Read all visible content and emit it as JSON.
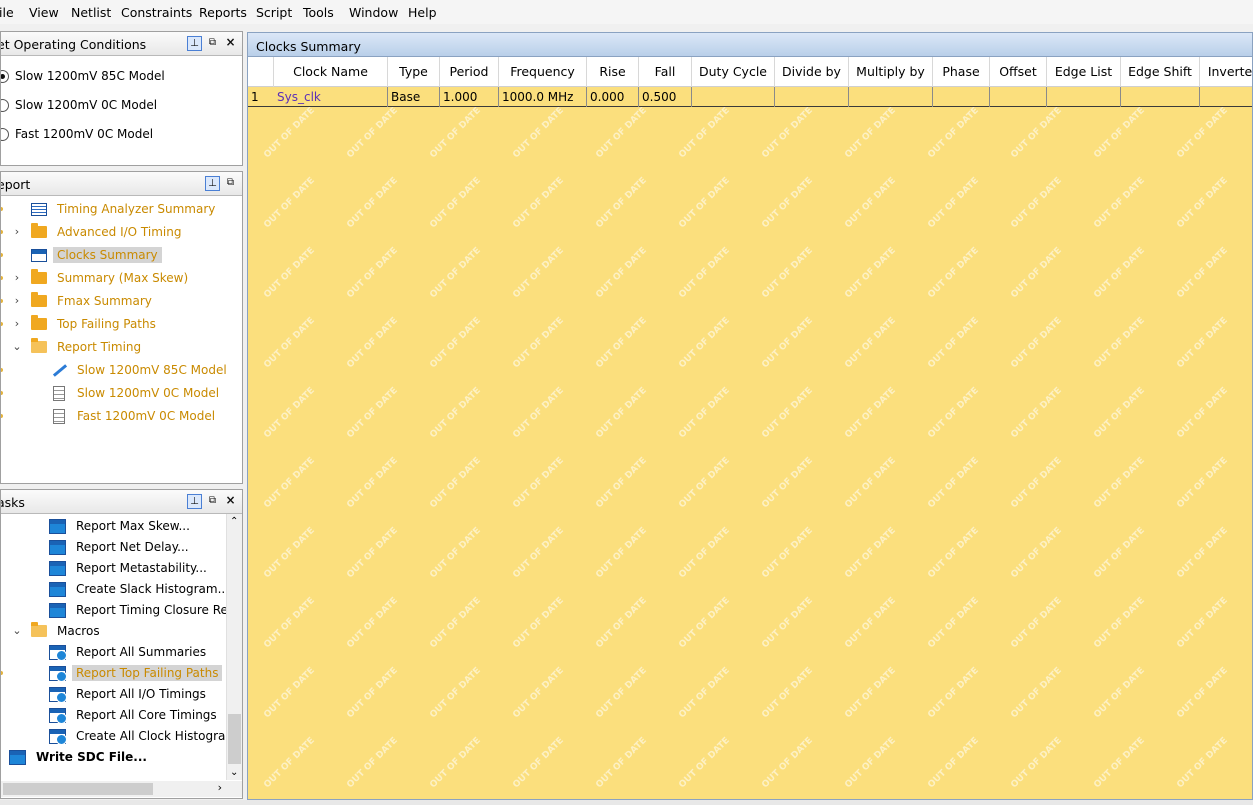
{
  "menubar": [
    "ile",
    "View",
    "Netlist",
    "Constraints",
    "Reports",
    "Script",
    "Tools",
    "Window",
    "Help"
  ],
  "operating_conditions": {
    "title": "et Operating Conditions",
    "options": [
      {
        "label": "Slow 1200mV 85C Model",
        "selected": true
      },
      {
        "label": "Slow 1200mV 0C Model",
        "selected": false
      },
      {
        "label": "Fast 1200mV 0C Model",
        "selected": false
      }
    ]
  },
  "report_panel": {
    "title": "eport",
    "items": [
      {
        "label": "Timing Analyzer Summary",
        "icon": "table-icon"
      },
      {
        "label": "Advanced I/O Timing",
        "icon": "folder-icon"
      },
      {
        "label": "Clocks Summary",
        "icon": "table-icon"
      },
      {
        "label": "Summary (Max Skew)",
        "icon": "folder-icon"
      },
      {
        "label": "Fmax Summary",
        "icon": "folder-icon"
      },
      {
        "label": "Top Failing Paths",
        "icon": "folder-icon"
      },
      {
        "label": "Report Timing",
        "icon": "folder-open-icon"
      },
      {
        "label": "Slow 1200mV 85C Model",
        "icon": "waveform-icon"
      },
      {
        "label": "Slow 1200mV 0C Model",
        "icon": "document-icon"
      },
      {
        "label": "Fast 1200mV 0C Model",
        "icon": "document-icon"
      }
    ]
  },
  "tasks_panel": {
    "title": "asks",
    "items": [
      {
        "label": "Report Max Skew...",
        "icon": "task-icon"
      },
      {
        "label": "Report Net Delay...",
        "icon": "task-icon"
      },
      {
        "label": "Report Metastability...",
        "icon": "task-icon"
      },
      {
        "label": "Create Slack Histogram...",
        "icon": "task-icon"
      },
      {
        "label": "Report Timing Closure Recor",
        "icon": "task-icon"
      },
      {
        "label": "Macros",
        "icon": "folder-open-icon"
      },
      {
        "label": "Report All Summaries",
        "icon": "macro-icon"
      },
      {
        "label": "Report Top Failing Paths",
        "icon": "macro-icon"
      },
      {
        "label": "Report All I/O Timings",
        "icon": "macro-icon"
      },
      {
        "label": "Report All Core Timings",
        "icon": "macro-icon"
      },
      {
        "label": "Create All Clock Histograms",
        "icon": "macro-icon"
      },
      {
        "label": "Write SDC File...",
        "icon": "task-icon"
      }
    ]
  },
  "main": {
    "title": "Clocks Summary",
    "columns": [
      "Clock Name",
      "Type",
      "Period",
      "Frequency",
      "Rise",
      "Fall",
      "Duty Cycle",
      "Divide by",
      "Multiply by",
      "Phase",
      "Offset",
      "Edge List",
      "Edge Shift",
      "Inverted"
    ],
    "rows": [
      {
        "index": "1",
        "cells": [
          "Sys_clk",
          "Base",
          "1.000",
          "1000.0 MHz",
          "0.000",
          "0.500",
          "",
          "",
          "",
          "",
          "",
          "",
          "",
          ""
        ]
      }
    ],
    "watermark": "OUT OF DATE",
    "colors": {
      "background": "#fbdf7d",
      "link": "#c98a00",
      "clock_name": "#5b2fb8"
    }
  }
}
